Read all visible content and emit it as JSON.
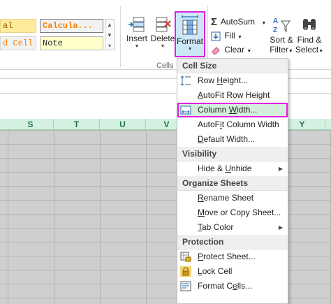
{
  "styles_gallery": {
    "items": [
      {
        "label": "al"
      },
      {
        "label": "Calcula..."
      },
      {
        "label": "d Cell"
      },
      {
        "label": "Note"
      }
    ],
    "scroll_up": "▲",
    "scroll_down": "▼",
    "more": "▾"
  },
  "cells_group": {
    "insert": "Insert",
    "delete": "Delete",
    "format": "Format",
    "group_label": "Cells"
  },
  "editing_group": {
    "autosum": "AutoSum",
    "fill": "Fill",
    "clear": "Clear",
    "sort_filter_line1": "Sort &",
    "sort_filter_line2": "Filter",
    "find_select_line1": "Find &",
    "find_select_line2": "Select"
  },
  "columns": [
    "S",
    "T",
    "U",
    "V",
    "Y"
  ],
  "format_menu": {
    "sections": [
      {
        "header": "Cell Size",
        "items": [
          {
            "pre": "Row ",
            "key": "H",
            "post": "eight...",
            "icon": "row-height-icon",
            "highlighted": false,
            "submenu": false
          },
          {
            "pre": "",
            "key": "A",
            "post": "utoFit Row Height",
            "icon": "",
            "highlighted": false,
            "submenu": false
          },
          {
            "pre": "Column ",
            "key": "W",
            "post": "idth...",
            "icon": "column-width-icon",
            "highlighted": true,
            "submenu": false
          },
          {
            "pre": "AutoF",
            "key": "i",
            "post": "t Column Width",
            "icon": "",
            "highlighted": false,
            "submenu": false
          },
          {
            "pre": "",
            "key": "D",
            "post": "efault Width...",
            "icon": "",
            "highlighted": false,
            "submenu": false
          }
        ]
      },
      {
        "header": "Visibility",
        "items": [
          {
            "pre": "Hide & ",
            "key": "U",
            "post": "nhide",
            "icon": "",
            "highlighted": false,
            "submenu": true
          }
        ]
      },
      {
        "header": "Organize Sheets",
        "items": [
          {
            "pre": "",
            "key": "R",
            "post": "ename Sheet",
            "icon": "",
            "highlighted": false,
            "submenu": false
          },
          {
            "pre": "",
            "key": "M",
            "post": "ove or Copy Sheet...",
            "icon": "",
            "highlighted": false,
            "submenu": false
          },
          {
            "pre": "",
            "key": "T",
            "post": "ab Color",
            "icon": "",
            "highlighted": false,
            "submenu": true
          }
        ]
      },
      {
        "header": "Protection",
        "items": [
          {
            "pre": "",
            "key": "P",
            "post": "rotect Sheet...",
            "icon": "protect-sheet-icon",
            "highlighted": false,
            "submenu": false
          },
          {
            "pre": "",
            "key": "L",
            "post": "ock Cell",
            "icon": "lock-icon",
            "highlighted": false,
            "submenu": false
          },
          {
            "pre": "Format C",
            "key": "e",
            "post": "lls...",
            "icon": "format-cells-icon",
            "highlighted": false,
            "submenu": false
          }
        ]
      }
    ],
    "submenu_arrow": "▶"
  },
  "colors": {
    "accent_highlight": "#e020e0",
    "format_button_bg": "#cde6f7",
    "hover_item_bg": "#d3eedb",
    "column_header_bg": "#d3f0e0",
    "column_header_text": "#217346"
  }
}
